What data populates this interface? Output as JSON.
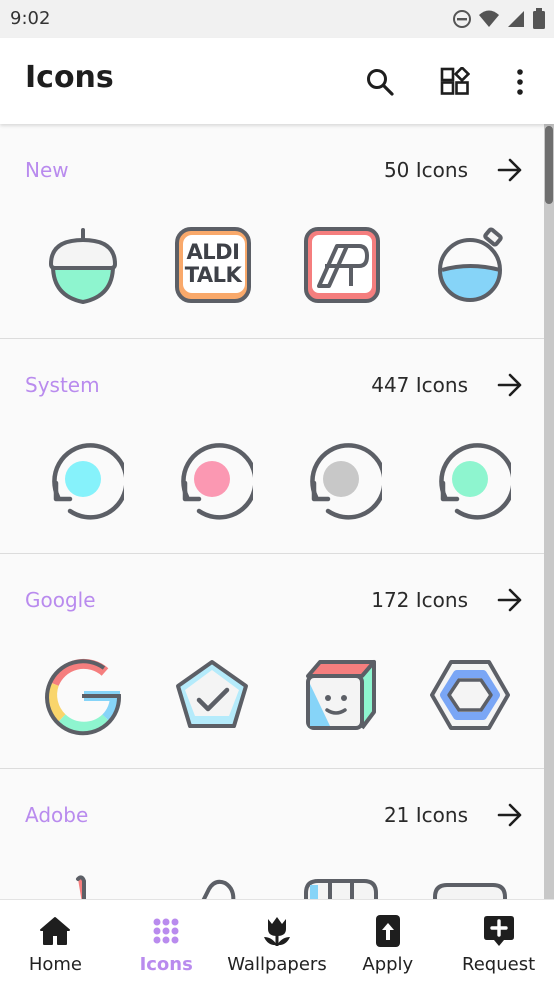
{
  "status_bar": {
    "time": "9:02"
  },
  "app_bar": {
    "title": "Icons"
  },
  "sections": [
    {
      "title": "New",
      "count": "50 Icons",
      "icons": [
        "acorn-icon",
        "aldi-talk-icon",
        "ap-icon",
        "potion-icon"
      ]
    },
    {
      "title": "System",
      "count": "447 Icons",
      "icons": [
        "cyan-refresh-icon",
        "pink-refresh-icon",
        "gray-refresh-icon",
        "green-refresh-icon"
      ]
    },
    {
      "title": "Google",
      "count": "172 Icons",
      "icons": [
        "google-icon",
        "pentagon-check-icon",
        "cube-face-icon",
        "hexagon-icon"
      ]
    },
    {
      "title": "Adobe",
      "count": "21 Icons",
      "icons": [
        "adobe-1-icon",
        "adobe-2-icon",
        "adobe-3-icon",
        "adobe-4-icon"
      ]
    }
  ],
  "aldi_text": {
    "line1": "ALDI",
    "line2": "TALK"
  },
  "bottom_nav": [
    {
      "label": "Home",
      "icon": "home-icon",
      "active": false
    },
    {
      "label": "Icons",
      "icon": "grid-icon",
      "active": true
    },
    {
      "label": "Wallpapers",
      "icon": "tulip-icon",
      "active": false
    },
    {
      "label": "Apply",
      "icon": "apply-icon",
      "active": false
    },
    {
      "label": "Request",
      "icon": "request-icon",
      "active": false
    }
  ],
  "colors": {
    "accent": "#b98bee",
    "outline": "#5c5f66",
    "mint": "#8ef5cf",
    "cyan": "#86f2fb",
    "pink": "#fb98b2",
    "gray": "#c8c8c8",
    "coral": "#f57e7e",
    "orange": "#f9a96b",
    "blue": "#7aa6f5"
  }
}
